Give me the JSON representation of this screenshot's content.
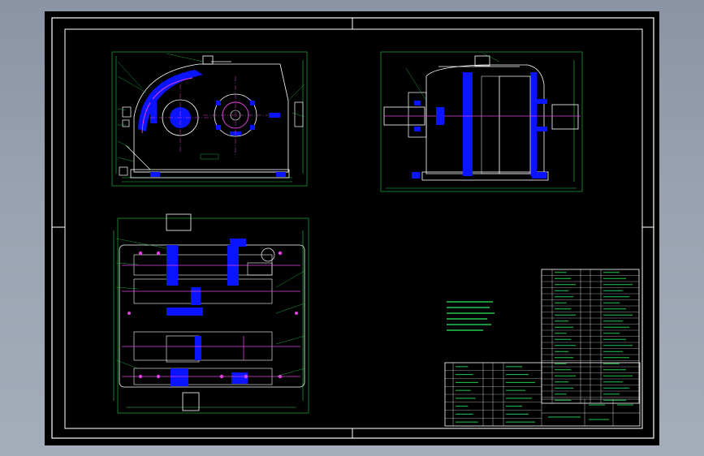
{
  "app": {
    "canvas_background": "#000000",
    "desktop_gradient": [
      "#8a94a4",
      "#a4adba"
    ]
  },
  "drawing": {
    "sheet_border_color": "#ffffff",
    "geometry_color": "#22c84a",
    "fill_color": "#0a14ff",
    "magenta_color": "#e040e0",
    "views": [
      "front-elevation",
      "side-elevation",
      "plan-section"
    ],
    "notes_block_lines": 5,
    "parts_list_rows": 22,
    "title_block_rows": 8
  }
}
